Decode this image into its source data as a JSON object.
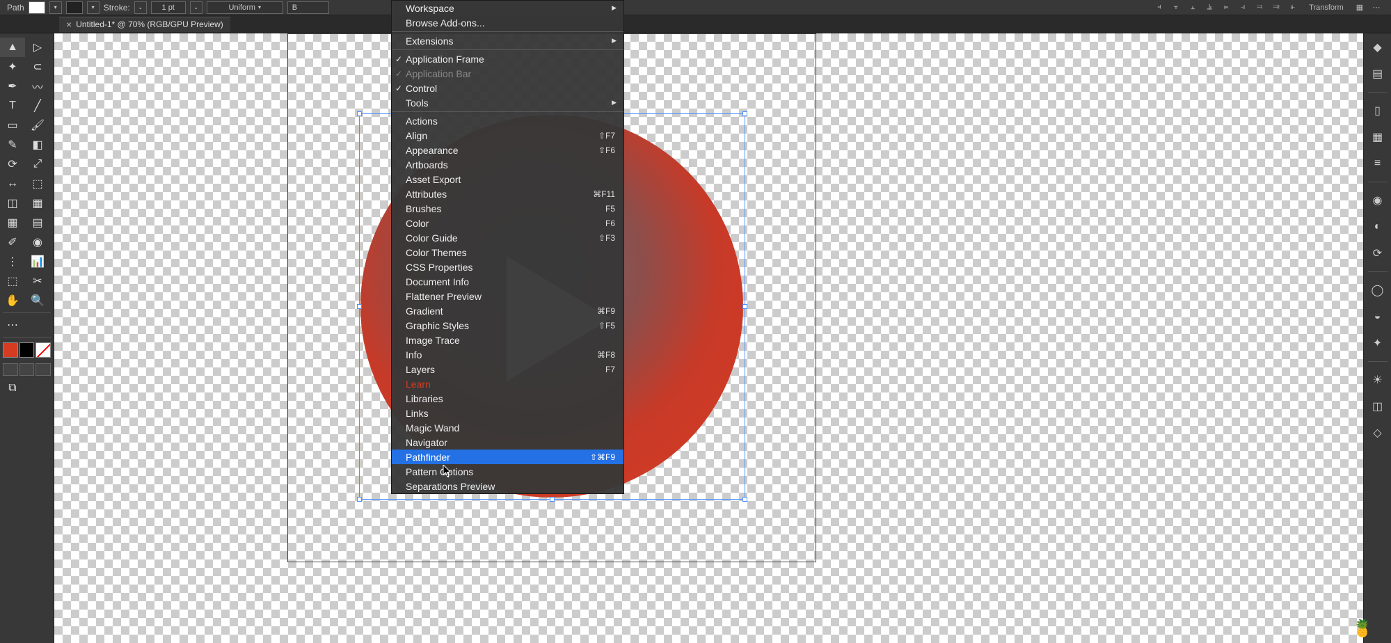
{
  "options_bar": {
    "path_label": "Path",
    "stroke_label": "Stroke:",
    "stroke_value": "1 pt",
    "profile": "Uniform",
    "brush_label": "B",
    "transform_label": "Transform"
  },
  "tab": {
    "close": "×",
    "title": "Untitled-1* @ 70% (RGB/GPU Preview)"
  },
  "tools": [
    [
      "selection-tool",
      "direct-selection-tool"
    ],
    [
      "magic-wand-tool",
      "lasso-tool"
    ],
    [
      "pen-tool",
      "curvature-tool"
    ],
    [
      "type-tool",
      "line-segment-tool"
    ],
    [
      "rectangle-tool",
      "paintbrush-tool"
    ],
    [
      "shaper-tool",
      "eraser-tool"
    ],
    [
      "rotate-tool",
      "scale-tool"
    ],
    [
      "width-tool",
      "free-transform-tool"
    ],
    [
      "shape-builder-tool",
      "perspective-grid-tool"
    ],
    [
      "mesh-tool",
      "gradient-tool"
    ],
    [
      "eyedropper-tool",
      "blend-tool"
    ],
    [
      "symbol-sprayer-tool",
      "column-graph-tool"
    ],
    [
      "artboard-tool",
      "slice-tool"
    ],
    [
      "hand-tool",
      "zoom-tool"
    ]
  ],
  "tool_glyphs": [
    [
      "▲",
      "▷"
    ],
    [
      "✦",
      "⊂"
    ],
    [
      "✒",
      "〰"
    ],
    [
      "T",
      "╱"
    ],
    [
      "▭",
      "🖌"
    ],
    [
      "✎",
      "◧"
    ],
    [
      "⟳",
      "⤢"
    ],
    [
      "↔",
      "⬚"
    ],
    [
      "◫",
      "▦"
    ],
    [
      "▦",
      "▤"
    ],
    [
      "✐",
      "◉"
    ],
    [
      "⋮",
      "📊"
    ],
    [
      "⬚",
      "✂"
    ],
    [
      "✋",
      "🔍"
    ]
  ],
  "right_panel_icons": [
    "properties-icon",
    "libraries-icon",
    "color-icon",
    "swatches-icon",
    "brushes-icon",
    "symbols-icon",
    "stroke-icon",
    "gradient-icon",
    "transparency-icon",
    "appearance-icon",
    "graphic-styles-icon",
    "layers-icon",
    "asset-export-icon",
    "artboards-icon"
  ],
  "right_panel_glyphs": [
    "◆",
    "▤",
    "▯",
    "▦",
    "≡",
    "◉",
    "◐",
    "⟳",
    "◯",
    "◒",
    "✦",
    "☀",
    "◫",
    "◇"
  ],
  "menu": {
    "workspace": "Workspace",
    "browse_addons": "Browse Add-ons...",
    "extensions": "Extensions",
    "application_frame": "Application Frame",
    "application_bar": "Application Bar",
    "control": "Control",
    "tools": "Tools",
    "actions": "Actions",
    "align": "Align",
    "align_sc": "⇧F7",
    "appearance": "Appearance",
    "appearance_sc": "⇧F6",
    "artboards": "Artboards",
    "asset_export": "Asset Export",
    "attributes": "Attributes",
    "attributes_sc": "⌘F11",
    "brushes": "Brushes",
    "brushes_sc": "F5",
    "color": "Color",
    "color_sc": "F6",
    "color_guide": "Color Guide",
    "color_guide_sc": "⇧F3",
    "color_themes": "Color Themes",
    "css_properties": "CSS Properties",
    "document_info": "Document Info",
    "flattener_preview": "Flattener Preview",
    "gradient": "Gradient",
    "gradient_sc": "⌘F9",
    "graphic_styles": "Graphic Styles",
    "graphic_styles_sc": "⇧F5",
    "image_trace": "Image Trace",
    "info": "Info",
    "info_sc": "⌘F8",
    "layers": "Layers",
    "layers_sc": "F7",
    "learn": "Learn",
    "libraries": "Libraries",
    "links": "Links",
    "magic_wand": "Magic Wand",
    "navigator": "Navigator",
    "pathfinder": "Pathfinder",
    "pathfinder_sc": "⇧⌘F9",
    "pattern_options": "Pattern Options",
    "separations_preview": "Separations Preview"
  },
  "watermark": "🍍"
}
